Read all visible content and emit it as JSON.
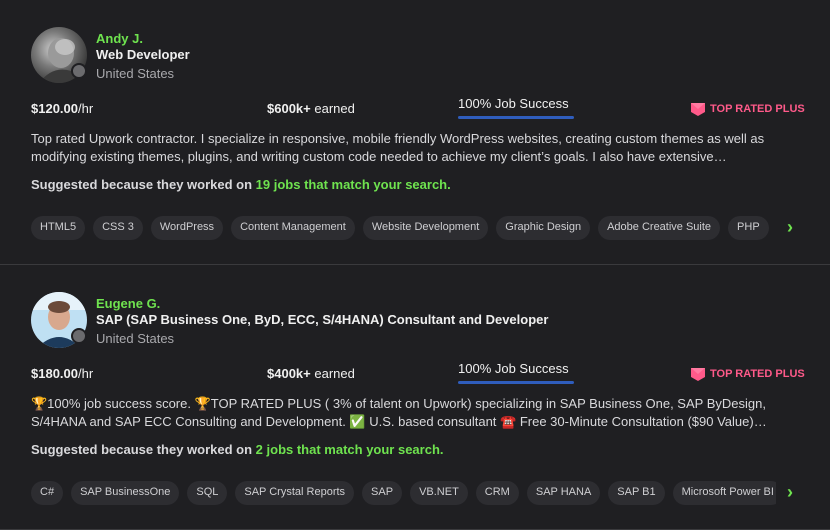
{
  "profiles": [
    {
      "name": "Andy J.",
      "title": "Web Developer",
      "location": "United States",
      "rate": "$120.00",
      "rate_unit": "/hr",
      "earned": "$600k+",
      "earned_label": " earned",
      "job_success": "100% Job Success",
      "badge": "TOP RATED PLUS",
      "description": "Top rated Upwork contractor. I specialize in responsive, mobile friendly WordPress websites, creating custom themes as well as modifying existing themes, plugins, and writing custom code needed to achieve my client’s goals. I also have extensive…",
      "suggest_prefix": "Suggested because they worked on ",
      "suggest_link": "19 jobs that match your search.",
      "skills": [
        "HTML5",
        "CSS 3",
        "WordPress",
        "Content Management",
        "Website Development",
        "Graphic Design",
        "Adobe Creative Suite",
        "PHP"
      ]
    },
    {
      "name": "Eugene G.",
      "title": "SAP (SAP Business One, ByD, ECC, S/4HANA) Consultant and Developer",
      "location": "United States",
      "rate": "$180.00",
      "rate_unit": "/hr",
      "earned": "$400k+",
      "earned_label": " earned",
      "job_success": "100% Job Success",
      "badge": "TOP RATED PLUS",
      "description": "🏆100% job success score. 🏆TOP RATED PLUS ( 3% of talent on Upwork) specializing in SAP Business One, SAP ByDesign, S/4HANA and SAP ECC Consulting and Development. ✅ U.S. based consultant ☎️ Free 30-Minute Consultation ($90 Value)…",
      "suggest_prefix": "Suggested because they worked on ",
      "suggest_link": "2 jobs that match your search.",
      "skills": [
        "C#",
        "SAP BusinessOne",
        "SQL",
        "SAP Crystal Reports",
        "SAP",
        "VB.NET",
        "CRM",
        "SAP HANA",
        "SAP B1",
        "Microsoft Power BI"
      ]
    }
  ],
  "colors": {
    "accent_green": "#6fe34f",
    "badge_pink": "#ff5a8a",
    "job_success_bar": "#2f5dbd"
  },
  "icons": {
    "badge": "top-rated-plus-badge-icon",
    "next": "chevron-right-icon"
  }
}
